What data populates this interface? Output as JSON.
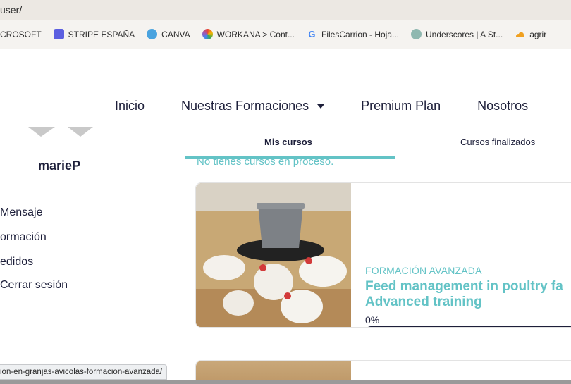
{
  "browser": {
    "url_fragment": "user/",
    "bookmarks": [
      {
        "label": "CROSOFT",
        "icon": "none-icon",
        "color": ""
      },
      {
        "label": "STRIPE ESPAÑA",
        "icon": "stripe-icon",
        "color": "#5b5fe0"
      },
      {
        "label": "CANVA",
        "icon": "canva-icon",
        "color": "#4aa3df"
      },
      {
        "label": "WORKANA > Cont...",
        "icon": "workana-icon",
        "color": "#e8443a"
      },
      {
        "label": "FilesCarrion - Hoja...",
        "icon": "google-icon",
        "color": "#4285f4"
      },
      {
        "label": "Underscores | A St...",
        "icon": "underscores-icon",
        "color": "#8fb8b0"
      },
      {
        "label": "agrir",
        "icon": "cloud-icon",
        "color": "#f0a020"
      }
    ],
    "status_url": "ion-en-granjas-avicolas-formacion-avanzada/"
  },
  "nav": {
    "items": [
      "Inicio",
      "Nuestras Formaciones",
      "Premium Plan",
      "Nosotros"
    ]
  },
  "profile": {
    "username": "marieP",
    "menu": [
      "Mensaje",
      "ormación",
      "edidos",
      "Cerrar sesión"
    ]
  },
  "tabs": {
    "active": "Mis cursos",
    "second": "Cursos finalizados"
  },
  "empty_message": "No tienes cursos en proceso.",
  "course": {
    "category": "FORMACIÓN AVANZADA",
    "title": "Feed management in poultry fa Advanced training",
    "progress_label": "0%",
    "progress_value": 0
  },
  "colors": {
    "accent": "#63c3c6",
    "text": "#1d1f3a"
  }
}
